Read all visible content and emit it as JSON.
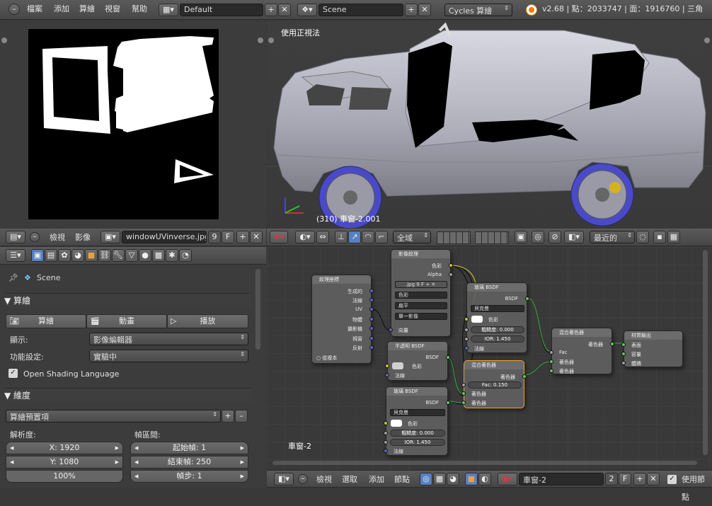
{
  "topbar": {
    "menus": [
      "檔案",
      "添加",
      "算繪",
      "視窗",
      "幫助"
    ],
    "screen": "Default",
    "scene": "Scene",
    "engine": "Cycles 算繪",
    "stats": "v2.68 | 點：2033747 | 面：1916760 | 三角"
  },
  "uv_editor": {
    "menus": [
      "檢視",
      "影像"
    ],
    "image_name": "windowUVinverse.jpg",
    "users": "9",
    "fake": "F"
  },
  "viewport": {
    "title": "使用正視法",
    "object_label": "(310) 車窗-2.001",
    "mode": "全域",
    "pivot": "最近的"
  },
  "properties": {
    "scene": "Scene",
    "render_section": "算繪",
    "render_btn": "算繪",
    "anim_btn": "動畫",
    "play_btn": "播放",
    "display_label": "顯示:",
    "display_value": "影像編輯器",
    "feature_label": "功能設定:",
    "feature_value": "實驗中",
    "osl_label": "Open Shading Language",
    "dim_section": "維度",
    "preset": "算繪預置項",
    "res_label": "解析度:",
    "range_label": "幀區間:",
    "res_x": "X: 1920",
    "res_y": "Y: 1080",
    "res_pct": "100%",
    "start": "起始幀: 1",
    "end": "結束幀: 250",
    "step": "幀步: 1"
  },
  "node_editor": {
    "menus": [
      "檢視",
      "選取",
      "添加",
      "節點"
    ],
    "material": "車窗-2",
    "users": "2",
    "fake": "F",
    "use_nodes": "使用節點",
    "frame_label": "車窗-2",
    "nodes": {
      "texcoord": {
        "title": "紋理座標",
        "outputs": [
          "生成的",
          "法線",
          "UV",
          "物體",
          "攝影機",
          "視窗",
          "反射"
        ],
        "checkbox": "從複本"
      },
      "image": {
        "title": "影像紋理",
        "out1": "色彩",
        "out2": "Alpha",
        "file": ".jpg",
        "users": "9",
        "fake": "F",
        "color": "色彩",
        "proj": "扁平",
        "ext": "單一影像",
        "in": "向量"
      },
      "glass1": {
        "title": "玻璃 BSDF",
        "out": "BSDF",
        "dist": "貝克曼",
        "color": "色彩",
        "rough": "粗糙度: 0.000",
        "ior": "IOR: 1.450",
        "normal": "法線"
      },
      "transp": {
        "title": "半透明 BSDF",
        "out": "BSDF",
        "color": "色彩",
        "normal": "法線"
      },
      "glass2": {
        "title": "玻璃 BSDF",
        "out": "BSDF",
        "dist": "貝克曼",
        "color": "色彩",
        "rough": "粗糙度: 0.000",
        "ior": "IOR: 1.450",
        "normal": "法線"
      },
      "mix1": {
        "title": "混合著色器",
        "out": "著色器",
        "fac": "Fac: 0.150",
        "in1": "著色器",
        "in2": "著色器"
      },
      "mix2": {
        "title": "混合著色器",
        "out": "著色器",
        "fac": "Fac",
        "in1": "著色器",
        "in2": "著色器"
      },
      "output": {
        "title": "材質輸出",
        "in1": "表面",
        "in2": "容量",
        "in3": "體積"
      }
    }
  },
  "colors": {
    "accent": "#e87d0d",
    "socket_yellow": "#c7c729",
    "socket_green": "#63c763",
    "socket_grey": "#a1a1a1",
    "socket_blue": "#6363c7",
    "selected_node": "#f0a22a"
  }
}
